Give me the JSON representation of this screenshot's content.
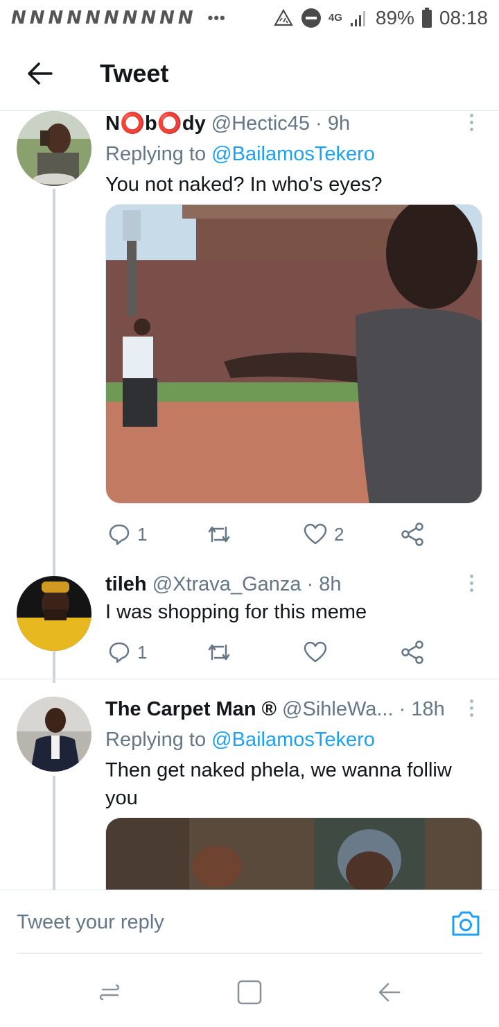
{
  "status_bar": {
    "carrier_logos": [
      "N",
      "N",
      "N",
      "N",
      "N",
      "N",
      "N",
      "N",
      "N",
      "N"
    ],
    "more_dots": "•••",
    "network": "4G",
    "battery": "89%",
    "time": "08:18"
  },
  "app_bar": {
    "back_icon": "arrow-left-icon",
    "title": "Tweet"
  },
  "tweets": [
    {
      "name": "N⭕b⭕dy",
      "handle": "@Hectic45",
      "time": "· 9h",
      "replying_prefix": "Replying to ",
      "replying_to": "@BailamosTekero",
      "text": "You not naked? In who's eyes?",
      "has_media": true,
      "replies": "1",
      "likes": "2"
    },
    {
      "name": "tileh",
      "handle": "@Xtrava_Ganza",
      "time": "· 8h",
      "text": "I was shopping for this meme",
      "replies": "1"
    },
    {
      "name": "The Carpet Man",
      "name_badge": "®",
      "handle": "@SihleWa...",
      "time": "· 18h",
      "replying_prefix": "Replying to ",
      "replying_to": "@BailamosTekero",
      "text": "Then get naked phela, we wanna folliw you",
      "has_media": true
    }
  ],
  "composer": {
    "placeholder": "Tweet your reply",
    "camera_icon": "camera-icon"
  },
  "nav_bar": {
    "recents_icon": "recents-icon",
    "home_icon": "home-icon",
    "back_icon": "back-icon"
  },
  "colors": {
    "accent": "#1da1f2",
    "secondary_text": "#657786",
    "primary_text": "#14171a"
  }
}
